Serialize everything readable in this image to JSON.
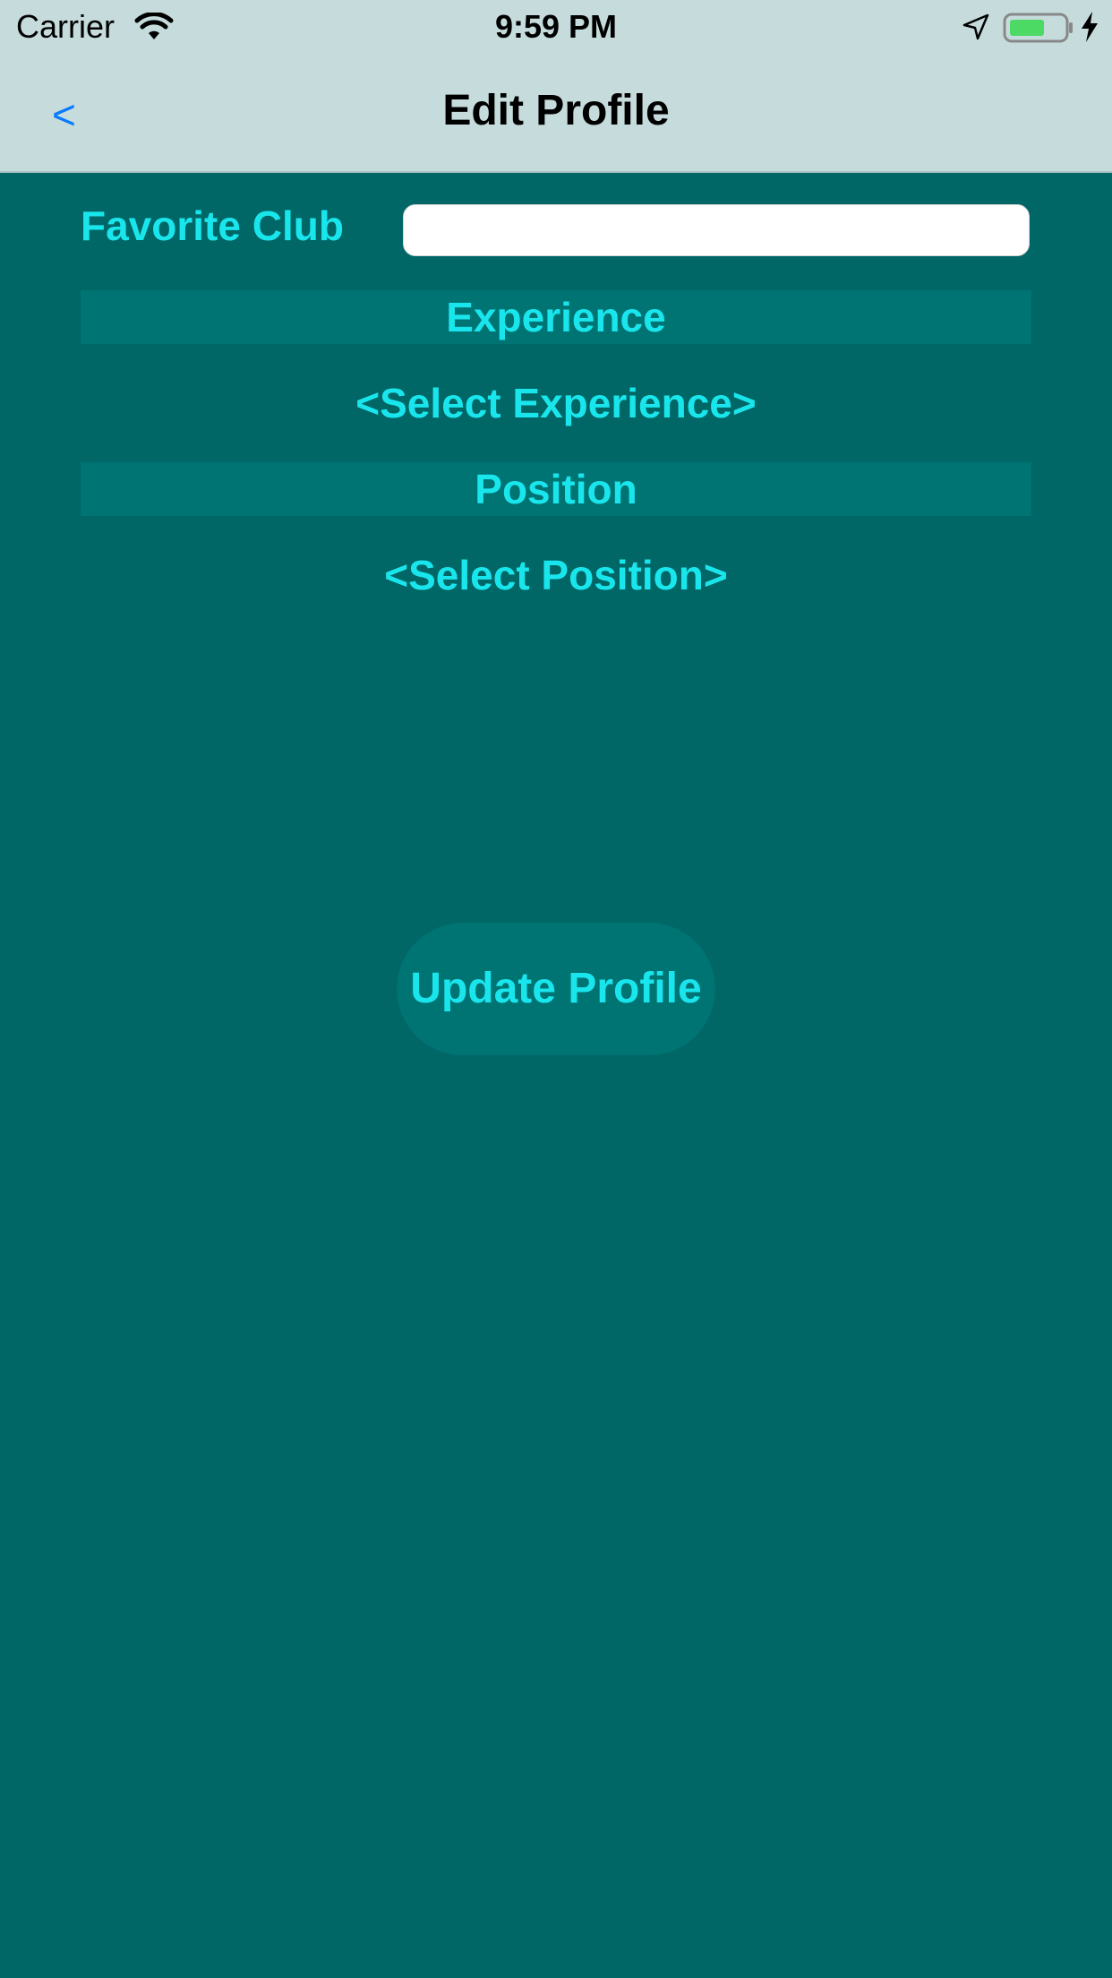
{
  "status_bar": {
    "carrier": "Carrier",
    "time": "9:59 PM",
    "icons": [
      "wifi-icon",
      "location-arrow-icon",
      "battery-icon",
      "charging-bolt-icon"
    ],
    "battery_color": "#4cd964"
  },
  "nav_bar": {
    "back_label": "<",
    "title": "Edit Profile",
    "background": "#c6dcdc",
    "accent": "#0a7aff"
  },
  "form": {
    "favorite_club_label": "Favorite Club",
    "favorite_club_value": "",
    "experience_header": "Experience",
    "experience_select": "<Select Experience>",
    "position_header": "Position",
    "position_select": "<Select Position>",
    "update_button": "Update Profile"
  },
  "colors": {
    "background": "#006666",
    "text": "#19e6ec",
    "header_background": "#007373"
  }
}
